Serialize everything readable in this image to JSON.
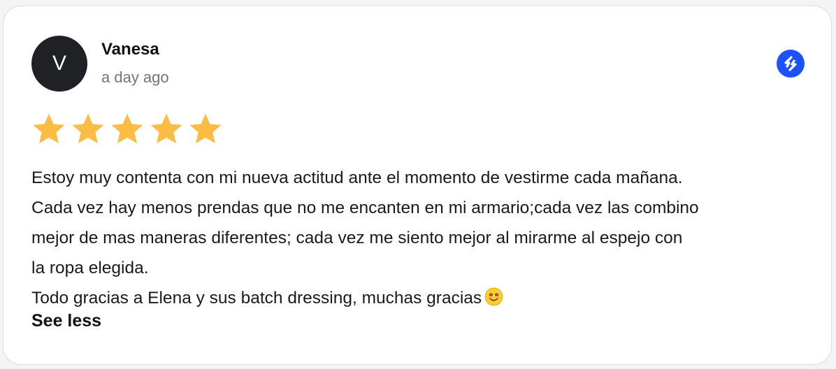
{
  "review": {
    "avatar_initial": "V",
    "author": "Vanesa",
    "timestamp": "a day ago",
    "rating": 5,
    "rating_max": 5,
    "text": "Estoy muy contenta con mi nueva actitud ante el momento de vestirme cada mañana.\nCada vez hay menos prendas que no me encanten en mi armario;cada vez las combino\nmejor  de mas maneras diferentes; cada vez me siento mejor al mirarme al espejo con\nla ropa elegida.\nTodo gracias a Elena y sus batch dressing, muchas gracias",
    "emoji": "smiling-face-emoji",
    "toggle_label": "See less",
    "source_icon": "review-source-icon"
  },
  "colors": {
    "star": "#fbbc42",
    "avatar_bg": "#202124",
    "source_badge": "#1a53ff",
    "text": "#1a1a1a",
    "muted": "#70757a"
  }
}
